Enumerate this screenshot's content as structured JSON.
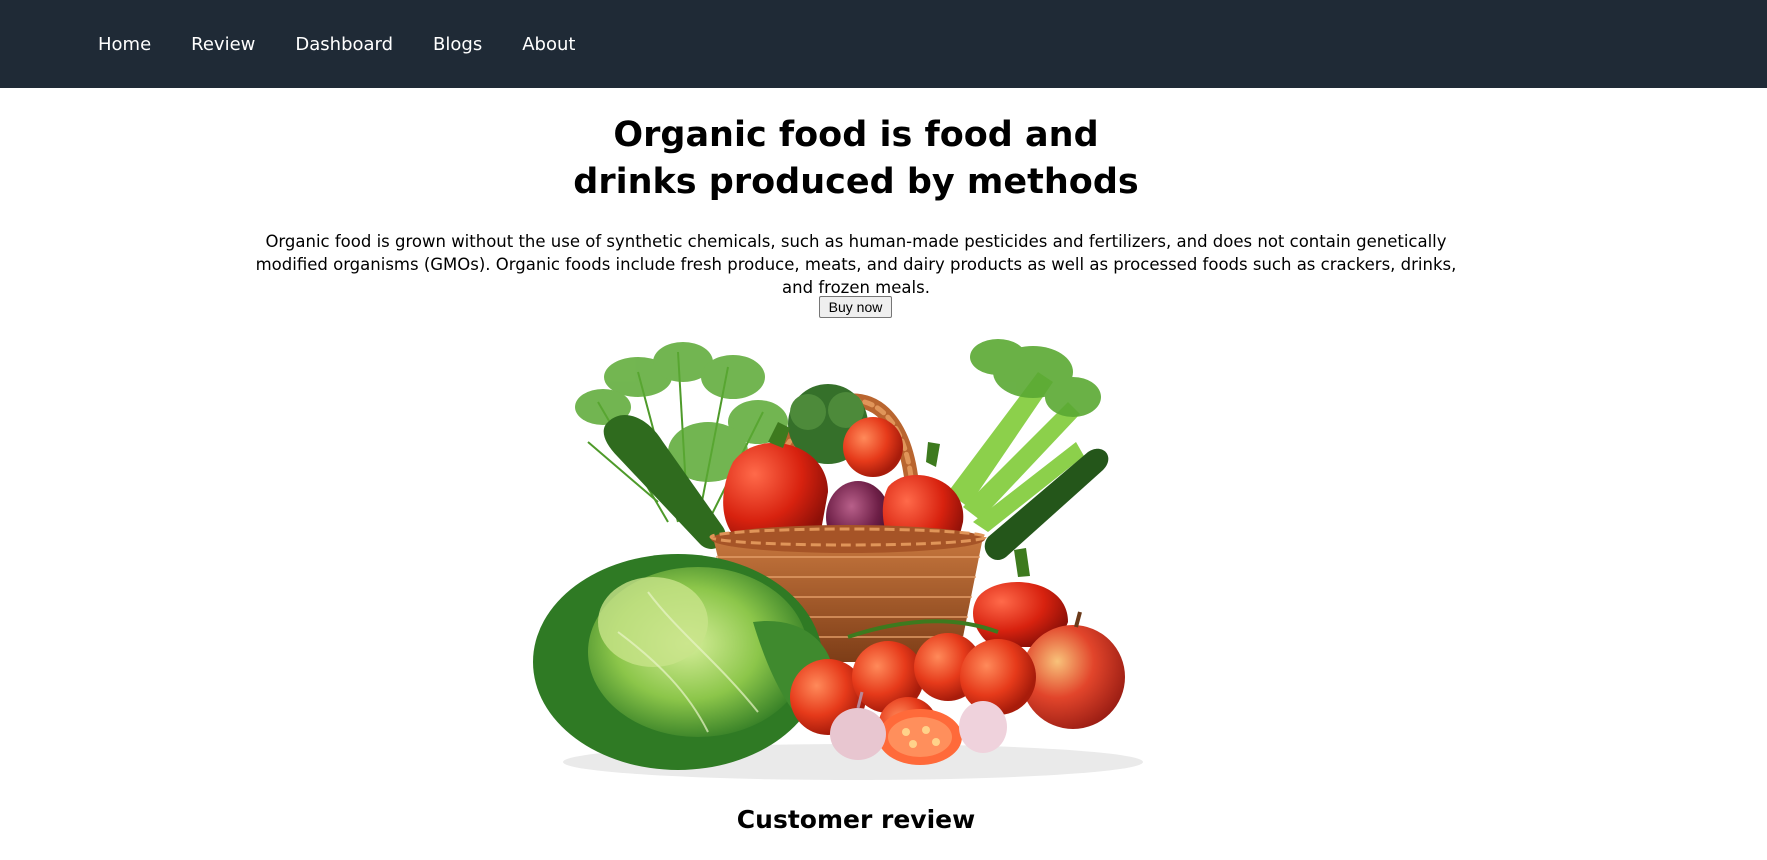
{
  "nav": {
    "items": [
      {
        "label": "Home"
      },
      {
        "label": "Review"
      },
      {
        "label": "Dashboard"
      },
      {
        "label": "Blogs"
      },
      {
        "label": "About"
      }
    ]
  },
  "hero": {
    "title_line1": "Organic food is food and",
    "title_line2": "drinks produced by methods",
    "description": "Organic food is grown without the use of synthetic chemicals, such as human-made pesticides and fertilizers, and does not contain genetically modified organisms (GMOs). Organic foods include fresh produce, meats, and dairy products as well as processed foods such as crackers, drinks, and frozen meals.",
    "buy_label": "Buy now",
    "image_subject": "vegetable-basket-image"
  },
  "reviews": {
    "heading": "Customer review"
  },
  "colors": {
    "navbar_bg": "#1f2a36",
    "nav_text": "#ffffff"
  }
}
